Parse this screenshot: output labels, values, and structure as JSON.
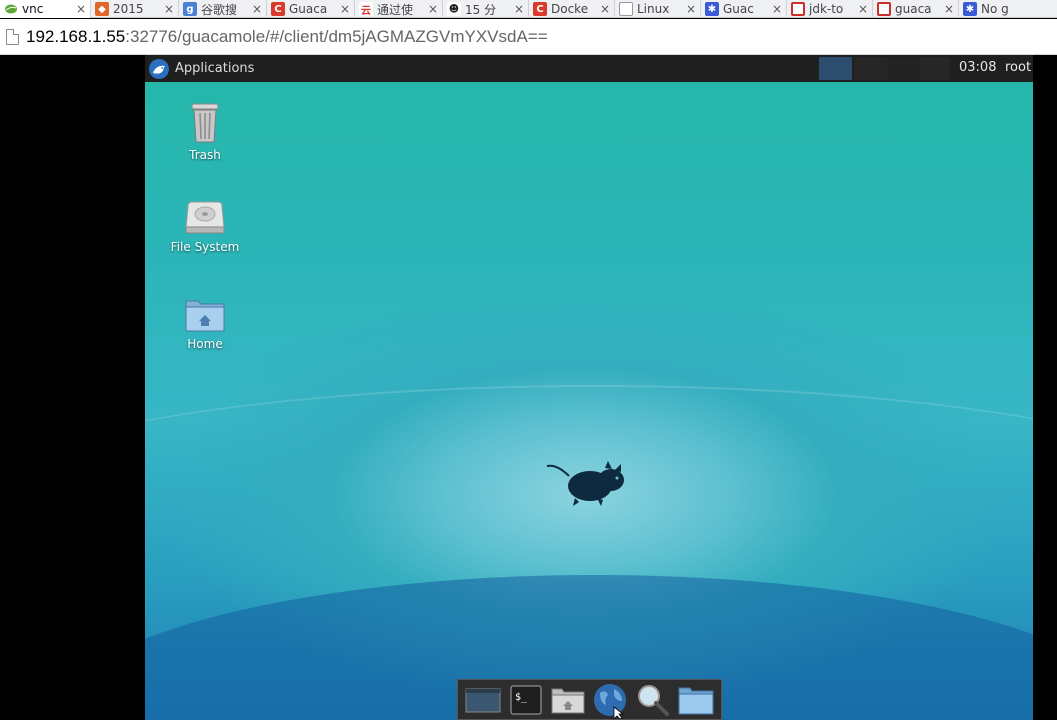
{
  "browser": {
    "tabs": [
      {
        "title": "vnc",
        "icon": "leaf-icon",
        "color": "#5aa83a",
        "active": true
      },
      {
        "title": "2015",
        "icon": "shield-icon",
        "color": "#e2662a"
      },
      {
        "title": "谷歌搜",
        "icon": "google-icon",
        "color": "#4a7fd6"
      },
      {
        "title": "Guaca",
        "icon": "c-icon",
        "color": "#d93a2b"
      },
      {
        "title": "通过使",
        "icon": "cloud-icon",
        "color": "#d9342b"
      },
      {
        "title": "15 分",
        "icon": "penguin-icon",
        "color": "#333333"
      },
      {
        "title": "Docke",
        "icon": "c-icon",
        "color": "#d93a2b"
      },
      {
        "title": "Linux",
        "icon": "page-icon",
        "color": "#888888"
      },
      {
        "title": "Guac",
        "icon": "paw-icon",
        "color": "#3a5bd6"
      },
      {
        "title": "jdk-to",
        "icon": "csdn-icon",
        "color": "#c9302c"
      },
      {
        "title": "guaca",
        "icon": "csdn-icon",
        "color": "#c9302c"
      },
      {
        "title": "No g",
        "icon": "paw-icon",
        "color": "#3a5bd6"
      }
    ],
    "url_host": "192.168.1.55",
    "url_rest": ":32776/guacamole/#/client/dm5jAGMAZGVmYXVsdA=="
  },
  "panel": {
    "applications_label": "Applications",
    "clock": "03:08",
    "user": "root"
  },
  "desktop_icons": [
    {
      "label": "Trash",
      "icon": "trash-icon"
    },
    {
      "label": "File System",
      "icon": "drive-icon"
    },
    {
      "label": "Home",
      "icon": "home-folder-icon"
    }
  ],
  "dock_items": [
    "show-desktop-icon",
    "terminal-icon",
    "file-manager-icon",
    "web-browser-icon",
    "search-icon",
    "folder-icon"
  ],
  "terminal_glyph": "$_",
  "tab_close": "×"
}
